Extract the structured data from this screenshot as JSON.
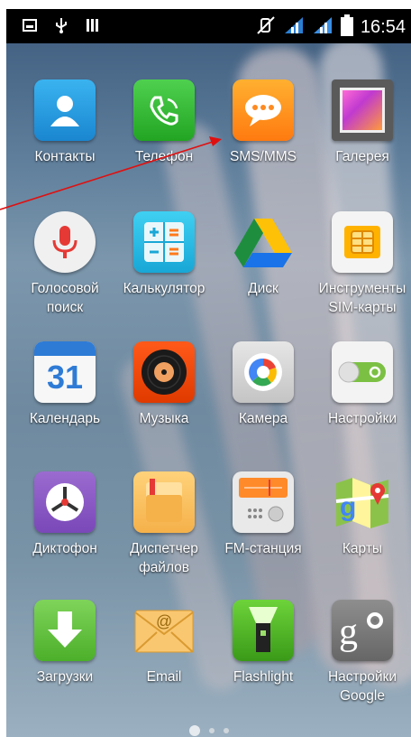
{
  "status_bar": {
    "time": "16:54"
  },
  "apps": [
    {
      "label": "Контакты"
    },
    {
      "label": "Телефон"
    },
    {
      "label": "SMS/MMS"
    },
    {
      "label": "Галерея"
    },
    {
      "label": "Голосовой поиск"
    },
    {
      "label": "Калькулятор"
    },
    {
      "label": "Диск"
    },
    {
      "label": "Инструменты SIM-карты"
    },
    {
      "label": "Календарь"
    },
    {
      "label": "Музыка"
    },
    {
      "label": "Камера"
    },
    {
      "label": "Настройки"
    },
    {
      "label": "Диктофон"
    },
    {
      "label": "Диспетчер файлов"
    },
    {
      "label": "FM-станция"
    },
    {
      "label": "Карты"
    },
    {
      "label": "Загрузки"
    },
    {
      "label": "Email"
    },
    {
      "label": "Flashlight"
    },
    {
      "label": "Настройки Google"
    }
  ],
  "calendar_day": "31",
  "colors": {
    "annotation_arrow": "#e01010"
  },
  "page_indicator": {
    "pages": 3,
    "current": 1
  }
}
